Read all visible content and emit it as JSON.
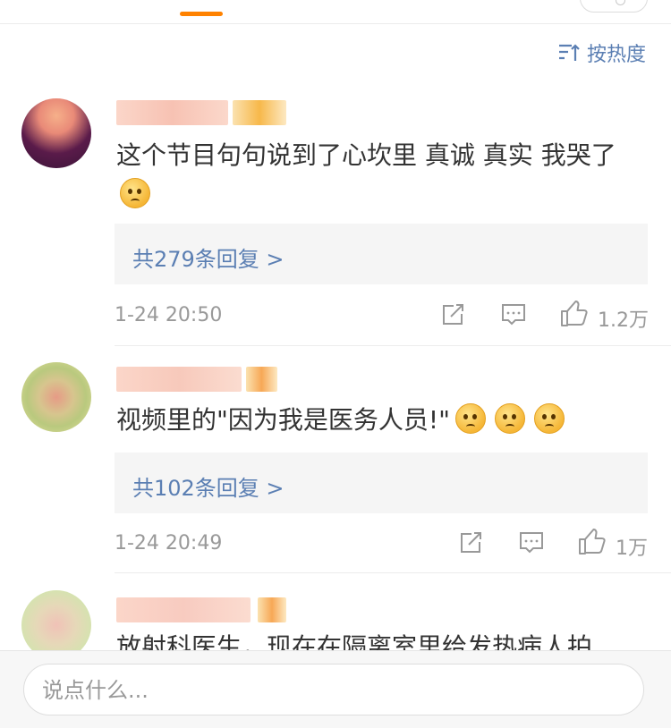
{
  "sort": {
    "label": "按热度"
  },
  "comments": [
    {
      "text": "这个节目句句说到了心坎里 真诚 真实 我哭了",
      "replies_label": "共279条回复 >",
      "time": "1-24 20:50",
      "likes": "1.2万",
      "emoji_count": 1
    },
    {
      "text": "视频里的\"因为我是医务人员!\"",
      "replies_label": "共102条回复 >",
      "time": "1-24 20:49",
      "likes": "1万",
      "emoji_count": 3
    },
    {
      "text": "放射科医生，现在在隔离室里给发热病人拍"
    }
  ],
  "input": {
    "placeholder": "说点什么..."
  },
  "colors": {
    "accent": "#ff8200",
    "link": "#5b7fb3",
    "meta": "#999999"
  }
}
